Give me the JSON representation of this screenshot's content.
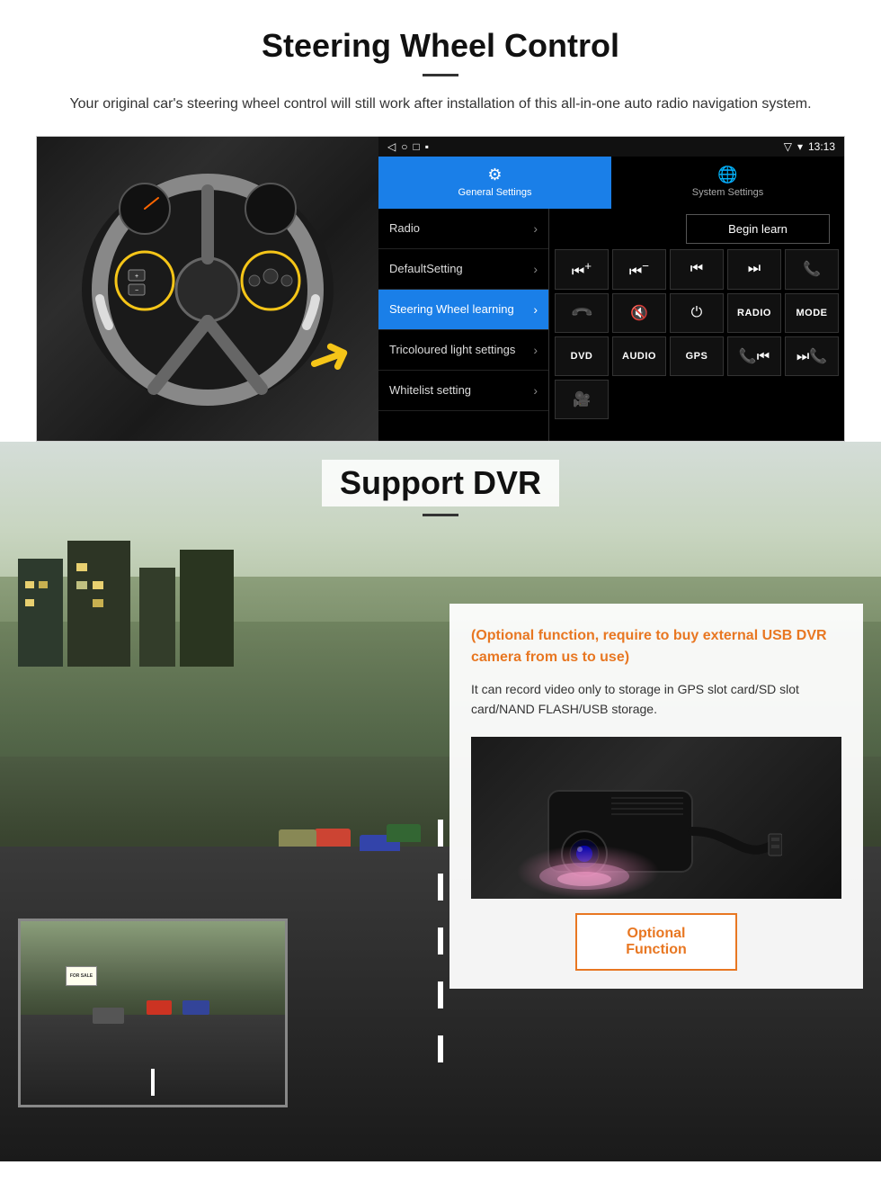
{
  "steering": {
    "title": "Steering Wheel Control",
    "subtitle": "Your original car's steering wheel control will still work after installation of this all-in-one auto radio navigation system.",
    "tabs": [
      {
        "label": "General Settings",
        "icon": "⚙",
        "active": true
      },
      {
        "label": "System Settings",
        "icon": "🌐",
        "active": false
      }
    ],
    "menu_items": [
      {
        "label": "Radio",
        "active": false
      },
      {
        "label": "DefaultSetting",
        "active": false
      },
      {
        "label": "Steering Wheel learning",
        "active": true
      },
      {
        "label": "Tricoloured light settings",
        "active": false
      },
      {
        "label": "Whitelist setting",
        "active": false
      }
    ],
    "begin_learn": "Begin learn",
    "control_buttons": [
      "⏮+",
      "⏮-",
      "⏮",
      "⏭",
      "📞",
      "↩",
      "🔇",
      "⏻",
      "RADIO",
      "MODE",
      "DVD",
      "AUDIO",
      "GPS",
      "📞⏮",
      "⏭📞"
    ],
    "status_bar": {
      "time": "13:13",
      "icons": "▽ ✦"
    }
  },
  "dvr": {
    "title": "Support DVR",
    "card": {
      "optional_text": "(Optional function, require to buy external USB DVR camera from us to use)",
      "description": "It can record video only to storage in GPS slot card/SD slot card/NAND FLASH/USB storage.",
      "button_label": "Optional Function"
    }
  }
}
